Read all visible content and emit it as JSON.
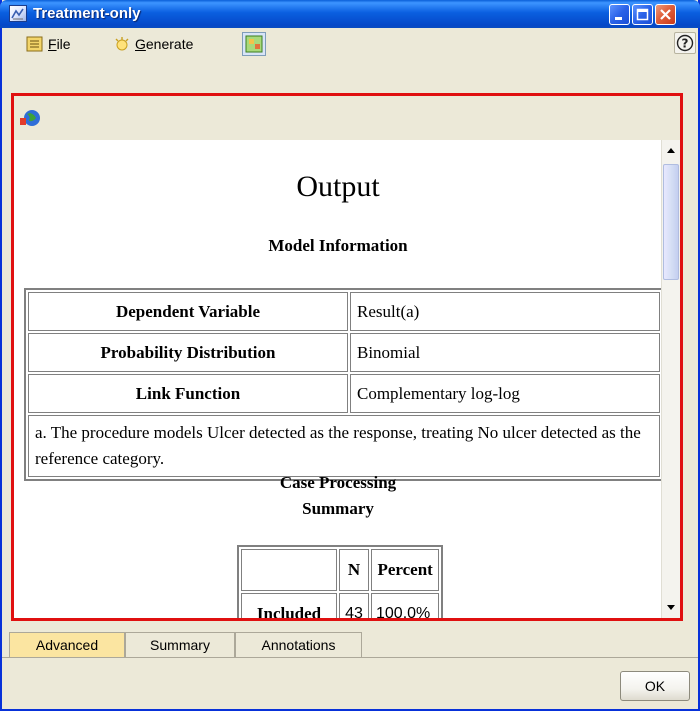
{
  "window": {
    "title": "Treatment-only"
  },
  "menu": {
    "file_label": "File",
    "file_mnemonic": "F",
    "file_rest": "ile",
    "generate_label": "Generate",
    "generate_mnemonic": "G",
    "generate_rest": "enerate"
  },
  "output": {
    "title": "Output",
    "model_info": {
      "caption": "Model Information",
      "rows": [
        {
          "label": "Dependent Variable",
          "value": "Result(a)"
        },
        {
          "label": "Probability Distribution",
          "value": "Binomial"
        },
        {
          "label": "Link Function",
          "value": "Complementary log-log"
        }
      ],
      "footnote": "a. The procedure models Ulcer detected as the response, treating No ulcer detected as the reference category."
    },
    "case_processing": {
      "caption_line1": "Case Processing",
      "caption_line2": "Summary",
      "headers": [
        "",
        "N",
        "Percent"
      ],
      "rows": [
        {
          "label": "Included",
          "n": "43",
          "percent": "100.0%"
        }
      ]
    }
  },
  "tabs": [
    "Advanced",
    "Summary",
    "Annotations"
  ],
  "active_tab": "Advanced",
  "ok_label": "OK"
}
